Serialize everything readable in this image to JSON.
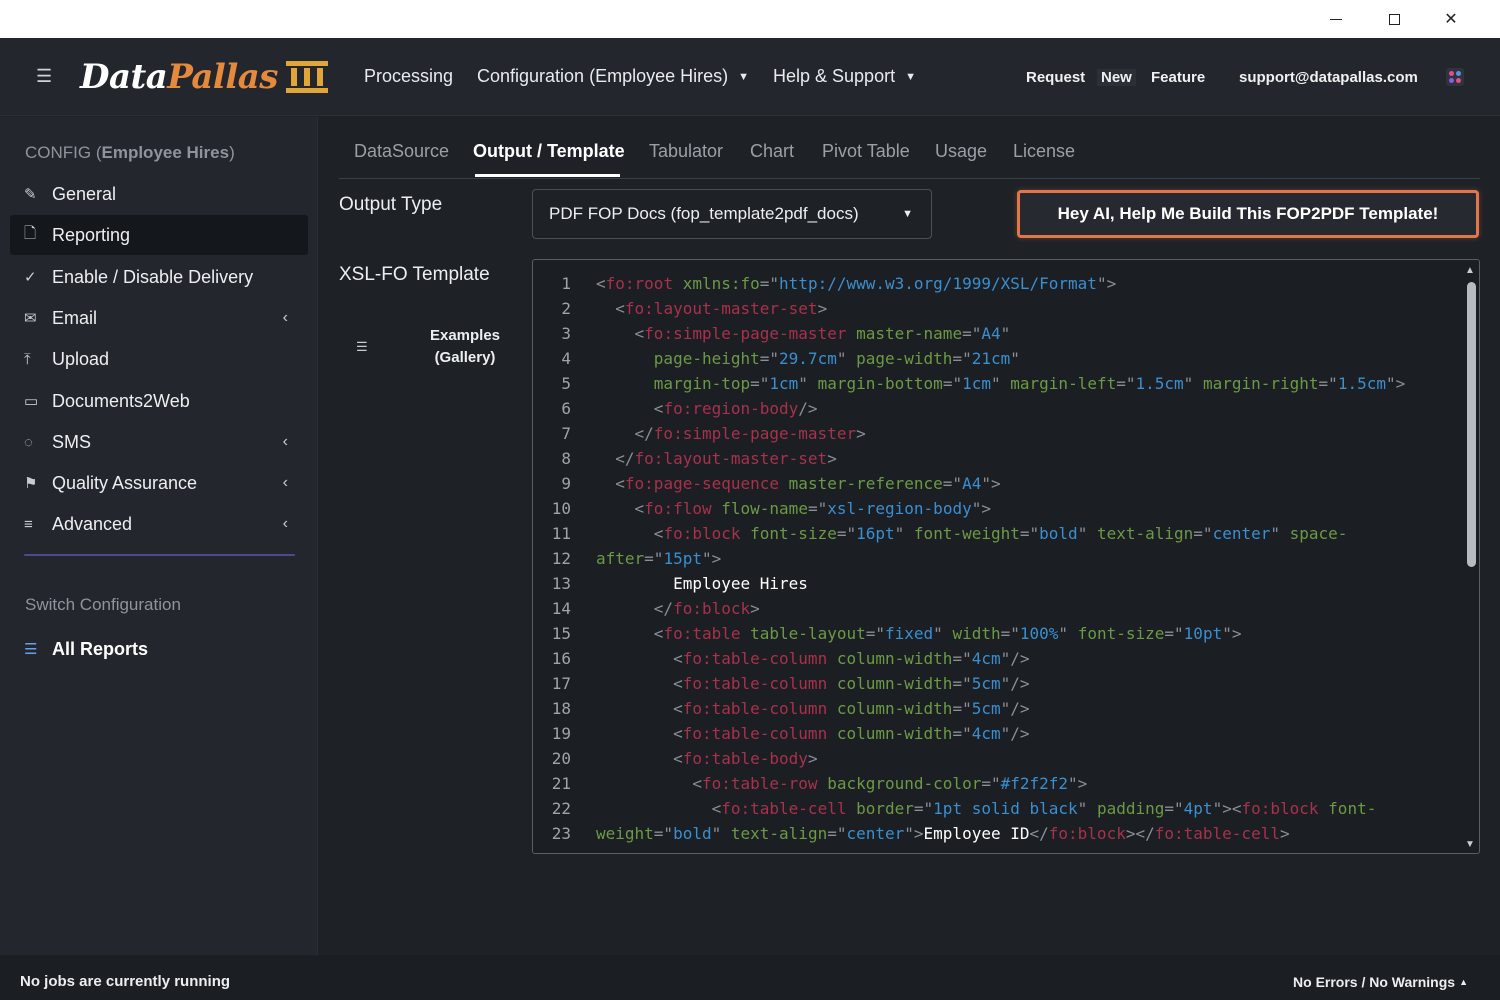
{
  "window": {
    "minimize_icon": "minimize-icon",
    "maximize_icon": "maximize-icon",
    "close_icon": "close-icon",
    "close_glyph": "✕"
  },
  "header": {
    "menu_icon": "☰",
    "logo_part1": "Data",
    "logo_part2": "Pallas",
    "nav": {
      "processing": "Processing",
      "configuration": "Configuration (Employee Hires)",
      "help": "Help & Support"
    },
    "request": "Request",
    "new": "New",
    "feature": "Feature",
    "support_email": "support@datapallas.com",
    "colors": {
      "brand_orange": "#e58a3c",
      "pillar_gold": "#e0a63a"
    }
  },
  "sidebar": {
    "title_prefix": "CONFIG (",
    "title_name": "Employee Hires",
    "title_suffix": ")",
    "items": [
      {
        "label": "General",
        "icon": "✎",
        "chevron": ""
      },
      {
        "label": "Reporting",
        "icon": "🗋",
        "chevron": ""
      },
      {
        "label": "Enable / Disable Delivery",
        "icon": "✓",
        "chevron": ""
      },
      {
        "label": "Email",
        "icon": "✉",
        "chevron": "‹"
      },
      {
        "label": "Upload",
        "icon": "⤒",
        "chevron": ""
      },
      {
        "label": "Documents2Web",
        "icon": "▭",
        "chevron": ""
      },
      {
        "label": "SMS",
        "icon": "◌",
        "chevron": "‹"
      },
      {
        "label": "Quality Assurance",
        "icon": "⚑",
        "chevron": "‹"
      },
      {
        "label": "Advanced",
        "icon": "≡",
        "chevron": "‹"
      }
    ],
    "switch_title": "Switch Configuration",
    "all_reports": "All Reports",
    "all_reports_icon": "☰"
  },
  "tabs": [
    "DataSource",
    "Output / Template",
    "Tabulator",
    "Chart",
    "Pivot Table",
    "Usage",
    "License"
  ],
  "active_tab": "Output / Template",
  "output_type": {
    "label": "Output Type",
    "selected": "PDF FOP Docs (fop_template2pdf_docs)",
    "arrow": "▼"
  },
  "ai_button": "Hey AI, Help Me Build This FOP2PDF Template!",
  "xsl": {
    "label": "XSL-FO Template",
    "examples_line1": "Examples",
    "examples_line2": "(Gallery)",
    "examples_icon": "☰"
  },
  "editor": {
    "line_numbers": [
      "1",
      "2",
      "3",
      "4",
      "5",
      "6",
      "7",
      "8",
      "9",
      "10",
      "11",
      "12",
      "13",
      "14",
      "15",
      "16",
      "17",
      "18",
      "19",
      "20",
      "21",
      "22",
      "23"
    ],
    "lines": [
      [
        [
          "br",
          "<"
        ],
        [
          "tg",
          "fo:root"
        ],
        [
          "tx",
          " "
        ],
        [
          "at",
          "xmlns:fo"
        ],
        [
          "br",
          "=\""
        ],
        [
          "st",
          "http://www.w3.org/1999/XSL/Format"
        ],
        [
          "br",
          "\">"
        ]
      ],
      [
        [
          "tx",
          "  "
        ],
        [
          "br",
          "<"
        ],
        [
          "tg",
          "fo:layout-master-set"
        ],
        [
          "br",
          ">"
        ]
      ],
      [
        [
          "tx",
          "    "
        ],
        [
          "br",
          "<"
        ],
        [
          "tg",
          "fo:simple-page-master"
        ],
        [
          "tx",
          " "
        ],
        [
          "at",
          "master-name"
        ],
        [
          "br",
          "=\""
        ],
        [
          "st",
          "A4"
        ],
        [
          "br",
          "\""
        ]
      ],
      [
        [
          "tx",
          "      "
        ],
        [
          "at",
          "page-height"
        ],
        [
          "br",
          "=\""
        ],
        [
          "st",
          "29.7cm"
        ],
        [
          "br",
          "\""
        ],
        [
          "tx",
          " "
        ],
        [
          "at",
          "page-width"
        ],
        [
          "br",
          "=\""
        ],
        [
          "st",
          "21cm"
        ],
        [
          "br",
          "\""
        ]
      ],
      [
        [
          "tx",
          "      "
        ],
        [
          "at",
          "margin-top"
        ],
        [
          "br",
          "=\""
        ],
        [
          "st",
          "1cm"
        ],
        [
          "br",
          "\""
        ],
        [
          "tx",
          " "
        ],
        [
          "at",
          "margin-bottom"
        ],
        [
          "br",
          "=\""
        ],
        [
          "st",
          "1cm"
        ],
        [
          "br",
          "\""
        ],
        [
          "tx",
          " "
        ],
        [
          "at",
          "margin-left"
        ],
        [
          "br",
          "=\""
        ],
        [
          "st",
          "1.5cm"
        ],
        [
          "br",
          "\""
        ],
        [
          "tx",
          " "
        ],
        [
          "at",
          "margin-right"
        ],
        [
          "br",
          "=\""
        ],
        [
          "st",
          "1.5cm"
        ],
        [
          "br",
          "\">"
        ]
      ],
      [
        [
          "tx",
          "      "
        ],
        [
          "br",
          "<"
        ],
        [
          "tg",
          "fo:region-body"
        ],
        [
          "br",
          "/>"
        ]
      ],
      [
        [
          "tx",
          "    "
        ],
        [
          "br",
          "</"
        ],
        [
          "tg",
          "fo:simple-page-master"
        ],
        [
          "br",
          ">"
        ]
      ],
      [
        [
          "tx",
          "  "
        ],
        [
          "br",
          "</"
        ],
        [
          "tg",
          "fo:layout-master-set"
        ],
        [
          "br",
          ">"
        ]
      ],
      [
        [
          "tx",
          "  "
        ],
        [
          "br",
          "<"
        ],
        [
          "tg",
          "fo:page-sequence"
        ],
        [
          "tx",
          " "
        ],
        [
          "at",
          "master-reference"
        ],
        [
          "br",
          "=\""
        ],
        [
          "st",
          "A4"
        ],
        [
          "br",
          "\">"
        ]
      ],
      [
        [
          "tx",
          "    "
        ],
        [
          "br",
          "<"
        ],
        [
          "tg",
          "fo:flow"
        ],
        [
          "tx",
          " "
        ],
        [
          "at",
          "flow-name"
        ],
        [
          "br",
          "=\""
        ],
        [
          "st",
          "xsl-region-body"
        ],
        [
          "br",
          "\">"
        ]
      ],
      [
        [
          "tx",
          "      "
        ],
        [
          "br",
          "<"
        ],
        [
          "tg",
          "fo:block"
        ],
        [
          "tx",
          " "
        ],
        [
          "at",
          "font-size"
        ],
        [
          "br",
          "=\""
        ],
        [
          "st",
          "16pt"
        ],
        [
          "br",
          "\""
        ],
        [
          "tx",
          " "
        ],
        [
          "at",
          "font-weight"
        ],
        [
          "br",
          "=\""
        ],
        [
          "st",
          "bold"
        ],
        [
          "br",
          "\""
        ],
        [
          "tx",
          " "
        ],
        [
          "at",
          "text-align"
        ],
        [
          "br",
          "=\""
        ],
        [
          "st",
          "center"
        ],
        [
          "br",
          "\""
        ],
        [
          "tx",
          " "
        ],
        [
          "at",
          "space-"
        ]
      ],
      [
        [
          "at",
          "after"
        ],
        [
          "br",
          "=\""
        ],
        [
          "st",
          "15pt"
        ],
        [
          "br",
          "\">"
        ]
      ],
      [
        [
          "tx",
          "        Employee Hires"
        ]
      ],
      [
        [
          "tx",
          "      "
        ],
        [
          "br",
          "</"
        ],
        [
          "tg",
          "fo:block"
        ],
        [
          "br",
          ">"
        ]
      ],
      [
        [
          "tx",
          "      "
        ],
        [
          "br",
          "<"
        ],
        [
          "tg",
          "fo:table"
        ],
        [
          "tx",
          " "
        ],
        [
          "at",
          "table-layout"
        ],
        [
          "br",
          "=\""
        ],
        [
          "st",
          "fixed"
        ],
        [
          "br",
          "\""
        ],
        [
          "tx",
          " "
        ],
        [
          "at",
          "width"
        ],
        [
          "br",
          "=\""
        ],
        [
          "st",
          "100%"
        ],
        [
          "br",
          "\""
        ],
        [
          "tx",
          " "
        ],
        [
          "at",
          "font-size"
        ],
        [
          "br",
          "=\""
        ],
        [
          "st",
          "10pt"
        ],
        [
          "br",
          "\">"
        ]
      ],
      [
        [
          "tx",
          "        "
        ],
        [
          "br",
          "<"
        ],
        [
          "tg",
          "fo:table-column"
        ],
        [
          "tx",
          " "
        ],
        [
          "at",
          "column-width"
        ],
        [
          "br",
          "=\""
        ],
        [
          "st",
          "4cm"
        ],
        [
          "br",
          "\"/>"
        ]
      ],
      [
        [
          "tx",
          "        "
        ],
        [
          "br",
          "<"
        ],
        [
          "tg",
          "fo:table-column"
        ],
        [
          "tx",
          " "
        ],
        [
          "at",
          "column-width"
        ],
        [
          "br",
          "=\""
        ],
        [
          "st",
          "5cm"
        ],
        [
          "br",
          "\"/>"
        ]
      ],
      [
        [
          "tx",
          "        "
        ],
        [
          "br",
          "<"
        ],
        [
          "tg",
          "fo:table-column"
        ],
        [
          "tx",
          " "
        ],
        [
          "at",
          "column-width"
        ],
        [
          "br",
          "=\""
        ],
        [
          "st",
          "5cm"
        ],
        [
          "br",
          "\"/>"
        ]
      ],
      [
        [
          "tx",
          "        "
        ],
        [
          "br",
          "<"
        ],
        [
          "tg",
          "fo:table-column"
        ],
        [
          "tx",
          " "
        ],
        [
          "at",
          "column-width"
        ],
        [
          "br",
          "=\""
        ],
        [
          "st",
          "4cm"
        ],
        [
          "br",
          "\"/>"
        ]
      ],
      [
        [
          "tx",
          "        "
        ],
        [
          "br",
          "<"
        ],
        [
          "tg",
          "fo:table-body"
        ],
        [
          "br",
          ">"
        ]
      ],
      [
        [
          "tx",
          "          "
        ],
        [
          "br",
          "<"
        ],
        [
          "tg",
          "fo:table-row"
        ],
        [
          "tx",
          " "
        ],
        [
          "at",
          "background-color"
        ],
        [
          "br",
          "=\""
        ],
        [
          "st",
          "#f2f2f2"
        ],
        [
          "br",
          "\">"
        ]
      ],
      [
        [
          "tx",
          "            "
        ],
        [
          "br",
          "<"
        ],
        [
          "tg",
          "fo:table-cell"
        ],
        [
          "tx",
          " "
        ],
        [
          "at",
          "border"
        ],
        [
          "br",
          "=\""
        ],
        [
          "st",
          "1pt solid black"
        ],
        [
          "br",
          "\""
        ],
        [
          "tx",
          " "
        ],
        [
          "at",
          "padding"
        ],
        [
          "br",
          "=\""
        ],
        [
          "st",
          "4pt"
        ],
        [
          "br",
          "\"><"
        ],
        [
          "tg",
          "fo:block"
        ],
        [
          "tx",
          " "
        ],
        [
          "at",
          "font-"
        ]
      ],
      [
        [
          "at",
          "weight"
        ],
        [
          "br",
          "=\""
        ],
        [
          "st",
          "bold"
        ],
        [
          "br",
          "\""
        ],
        [
          "tx",
          " "
        ],
        [
          "at",
          "text-align"
        ],
        [
          "br",
          "=\""
        ],
        [
          "st",
          "center"
        ],
        [
          "br",
          "\">"
        ],
        [
          "tx",
          "Employee ID"
        ],
        [
          "br",
          "</"
        ],
        [
          "tg",
          "fo:block"
        ],
        [
          "br",
          "></"
        ],
        [
          "tg",
          "fo:table-cell"
        ],
        [
          "br",
          ">"
        ]
      ]
    ],
    "scroll_up": "▲",
    "scroll_down": "▼"
  },
  "status": {
    "left": "No jobs are currently running",
    "right": "No Errors / No Warnings",
    "right_icon": "▲"
  }
}
